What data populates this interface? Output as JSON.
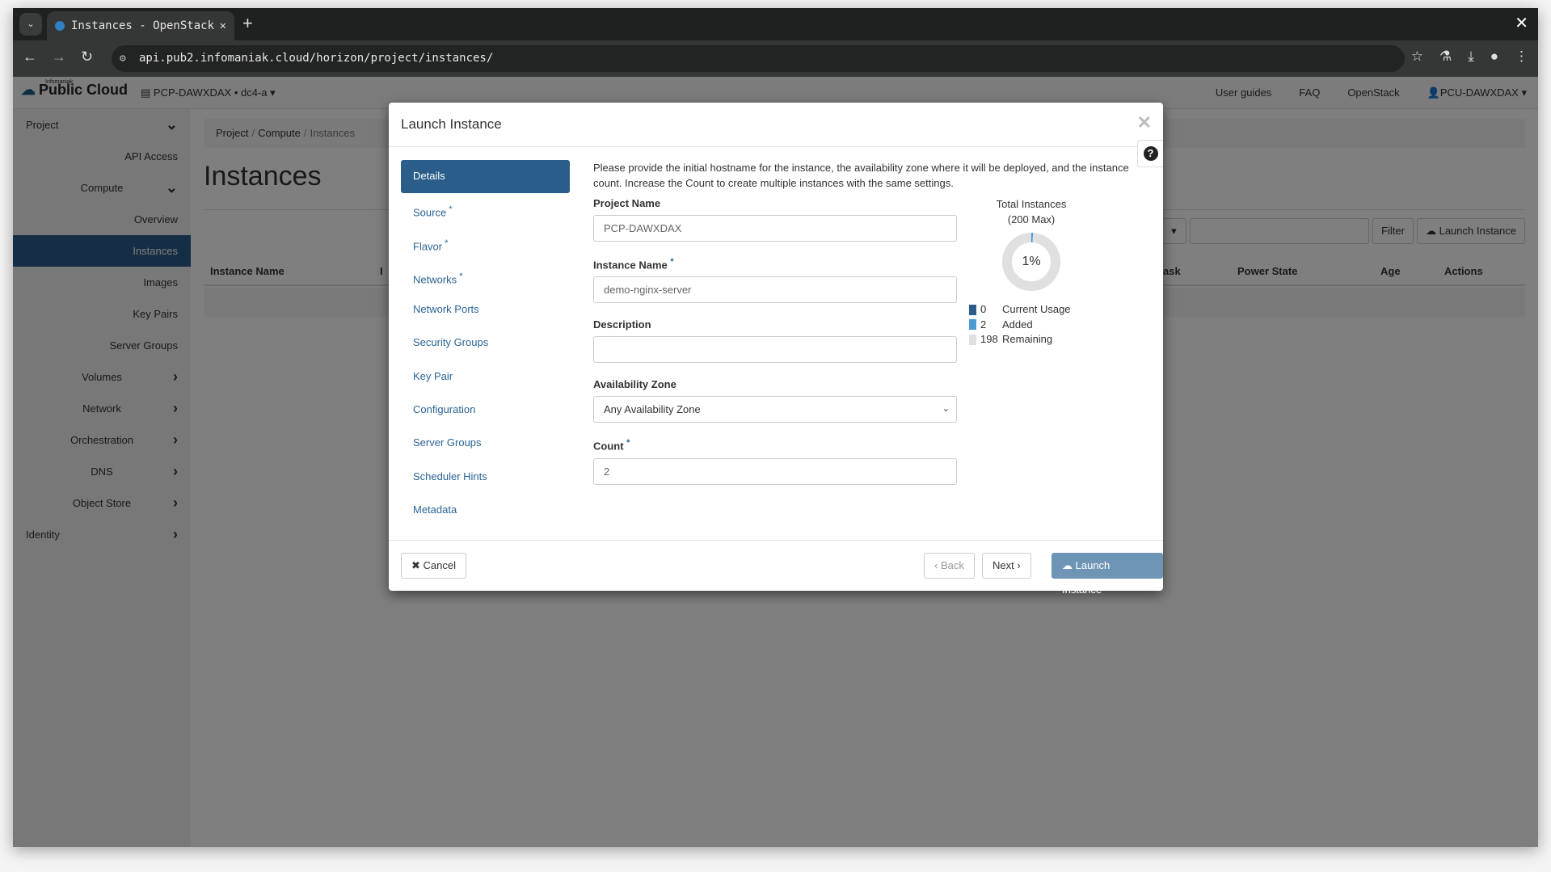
{
  "browser": {
    "tab_title": "Instances - OpenStack",
    "url": "api.pub2.infomaniak.cloud/horizon/project/instances/"
  },
  "topnav": {
    "brand_small": "Infomaniak",
    "brand": "Public Cloud",
    "project": "PCP-DAWXDAX • dc4-a ▾",
    "links": [
      "User guides",
      "FAQ",
      "OpenStack",
      "PCU-DAWXDAX ▾"
    ]
  },
  "sidebar": [
    {
      "label": "Project",
      "kind": "top",
      "chevron": "chevron-down"
    },
    {
      "label": "API Access",
      "kind": "item"
    },
    {
      "label": "Compute",
      "kind": "group",
      "chevron": "chevron-down"
    },
    {
      "label": "Overview",
      "kind": "item"
    },
    {
      "label": "Instances",
      "kind": "item",
      "active": true
    },
    {
      "label": "Images",
      "kind": "item"
    },
    {
      "label": "Key Pairs",
      "kind": "item"
    },
    {
      "label": "Server Groups",
      "kind": "item"
    },
    {
      "label": "Volumes",
      "kind": "group",
      "chevron": "chevron-right"
    },
    {
      "label": "Network",
      "kind": "group",
      "chevron": "chevron-right"
    },
    {
      "label": "Orchestration",
      "kind": "group",
      "chevron": "chevron-right"
    },
    {
      "label": "DNS",
      "kind": "group",
      "chevron": "chevron-right"
    },
    {
      "label": "Object Store",
      "kind": "group",
      "chevron": "chevron-right"
    },
    {
      "label": "Identity",
      "kind": "top",
      "chevron": "chevron-right"
    }
  ],
  "main": {
    "breadcrumb": [
      "Project",
      "Compute",
      "Instances"
    ],
    "title": "Instances",
    "filter_label": "Filter",
    "launch_label": "Launch Instance",
    "columns": [
      {
        "label": "Instance Name"
      },
      {
        "label": "I"
      },
      {
        "label": "ask"
      },
      {
        "label": "Power State"
      },
      {
        "label": "Age"
      },
      {
        "label": "Actions"
      }
    ]
  },
  "modal": {
    "title": "Launch Instance",
    "steps": [
      {
        "label": "Details",
        "active": true
      },
      {
        "label": "Source",
        "required": true
      },
      {
        "label": "Flavor",
        "required": true
      },
      {
        "label": "Networks",
        "required": true
      },
      {
        "label": "Network Ports"
      },
      {
        "label": "Security Groups"
      },
      {
        "label": "Key Pair"
      },
      {
        "label": "Configuration"
      },
      {
        "label": "Server Groups"
      },
      {
        "label": "Scheduler Hints"
      },
      {
        "label": "Metadata"
      }
    ],
    "intro": "Please provide the initial hostname for the instance, the availability zone where it will be deployed, and the instance count. Increase the Count to create multiple instances with the same settings.",
    "fields": {
      "project_name": {
        "label": "Project Name",
        "value": "PCP-DAWXDAX"
      },
      "instance_name": {
        "label": "Instance Name",
        "value": "demo-nginx-server"
      },
      "description": {
        "label": "Description",
        "value": ""
      },
      "availability_zone": {
        "label": "Availability Zone",
        "value": "Any Availability Zone"
      },
      "count": {
        "label": "Count",
        "value": "2"
      }
    },
    "quota": {
      "title": "Total Instances",
      "max": "(200 Max)",
      "percent": "1%",
      "current": 0,
      "added": 2,
      "remaining": 198,
      "labels": [
        "Current Usage",
        "Added",
        "Remaining"
      ],
      "colors": {
        "current": "#2a5d8a",
        "added": "#4a9ad4",
        "remaining": "#e0e0e0"
      }
    },
    "buttons": {
      "cancel": "Cancel",
      "back": "Back",
      "next": "Next",
      "launch": "Launch Instance"
    }
  }
}
